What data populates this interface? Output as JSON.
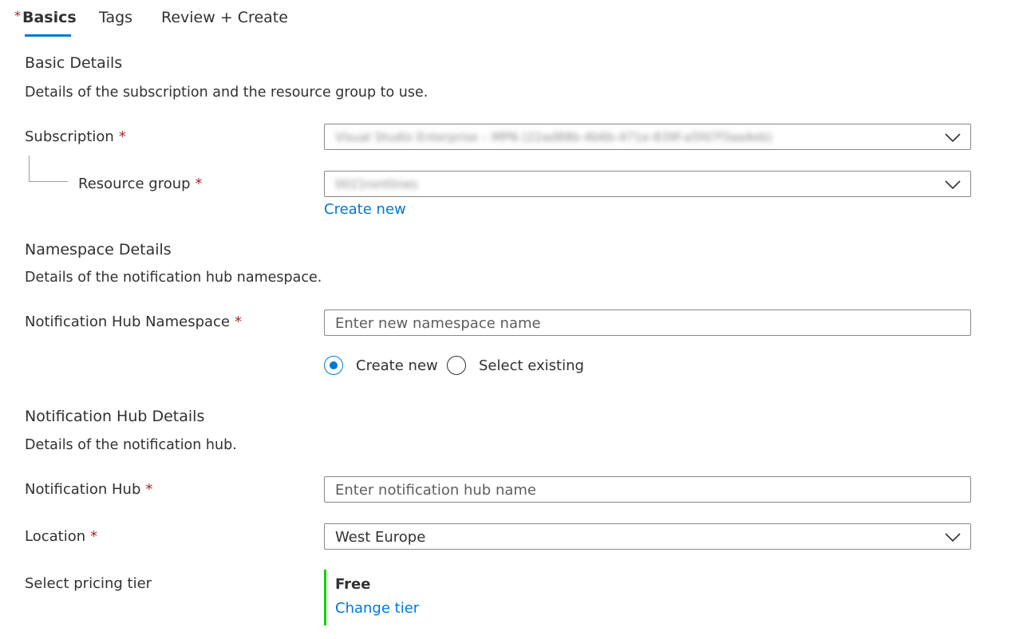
{
  "tabs": [
    {
      "label": "Basics",
      "required": "*",
      "active": true
    },
    {
      "label": "Tags",
      "active": false
    },
    {
      "label": "Review + Create",
      "active": false
    }
  ],
  "basic_details": {
    "title": "Basic Details",
    "description": "Details of the subscription and the resource group to use.",
    "subscription": {
      "label": "Subscription",
      "required": "*",
      "value": "Visual Studio Enterprise – MPN (22ad88b-4b6b-471e-839f-a5fd7f3aa4eb)"
    },
    "resource_group": {
      "label": "Resource group",
      "required": "*",
      "value": "0021rontlines",
      "create_new": "Create new"
    }
  },
  "namespace_details": {
    "title": "Namespace Details",
    "description": "Details of the notification hub namespace.",
    "namespace": {
      "label": "Notification Hub Namespace",
      "required": "*",
      "placeholder": "Enter new namespace name"
    },
    "radio_options": [
      {
        "label": "Create new",
        "checked": true
      },
      {
        "label": "Select existing",
        "checked": false
      }
    ]
  },
  "hub_details": {
    "title": "Notification Hub Details",
    "description": "Details of the notification hub.",
    "hub": {
      "label": "Notification Hub",
      "required": "*",
      "placeholder": "Enter notification hub name"
    },
    "location": {
      "label": "Location",
      "required": "*",
      "value": "West Europe"
    },
    "pricing": {
      "label": "Select pricing tier",
      "tier": "Free",
      "change": "Change tier"
    }
  },
  "colors": {
    "accent": "#0078d4",
    "required": "#a4262c",
    "tier_bar": "#13d10a",
    "text": "#323130"
  }
}
